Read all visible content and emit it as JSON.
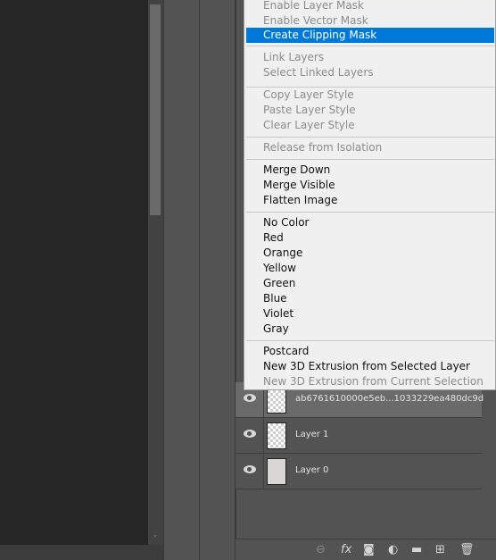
{
  "menu": {
    "items": [
      {
        "label": "Enable Layer Mask",
        "enabled": false
      },
      {
        "label": "Enable Vector Mask",
        "enabled": false
      },
      {
        "label": "Create Clipping Mask",
        "enabled": true,
        "highlighted": true
      },
      {
        "label": "Link Layers",
        "enabled": false
      },
      {
        "label": "Select Linked Layers",
        "enabled": false
      },
      {
        "label": "Copy Layer Style",
        "enabled": false
      },
      {
        "label": "Paste Layer Style",
        "enabled": false
      },
      {
        "label": "Clear Layer Style",
        "enabled": false
      },
      {
        "label": "Release from Isolation",
        "enabled": false
      },
      {
        "label": "Merge Down",
        "enabled": true
      },
      {
        "label": "Merge Visible",
        "enabled": true
      },
      {
        "label": "Flatten Image",
        "enabled": true
      },
      {
        "label": "No Color",
        "enabled": true
      },
      {
        "label": "Red",
        "enabled": true
      },
      {
        "label": "Orange",
        "enabled": true
      },
      {
        "label": "Yellow",
        "enabled": true
      },
      {
        "label": "Green",
        "enabled": true
      },
      {
        "label": "Blue",
        "enabled": true
      },
      {
        "label": "Violet",
        "enabled": true
      },
      {
        "label": "Gray",
        "enabled": true
      },
      {
        "label": "Postcard",
        "enabled": true
      },
      {
        "label": "New 3D Extrusion from Selected Layer",
        "enabled": true
      },
      {
        "label": "New 3D Extrusion from Current Selection",
        "enabled": false
      }
    ],
    "highlight_color": "#0078d7"
  },
  "layers": [
    {
      "name": "ab6761610000e5eb...1033229ea480dc9d",
      "visible": true,
      "selected": true,
      "type": "smart-object"
    },
    {
      "name": "Layer 1",
      "visible": true,
      "selected": false,
      "type": "transparent"
    },
    {
      "name": "Layer 0",
      "visible": true,
      "selected": false,
      "type": "photo"
    }
  ],
  "footer_icons": [
    "link-icon",
    "fx-icon",
    "mask-icon",
    "adjustment-icon",
    "folder-icon",
    "new-layer-icon",
    "trash-icon"
  ]
}
